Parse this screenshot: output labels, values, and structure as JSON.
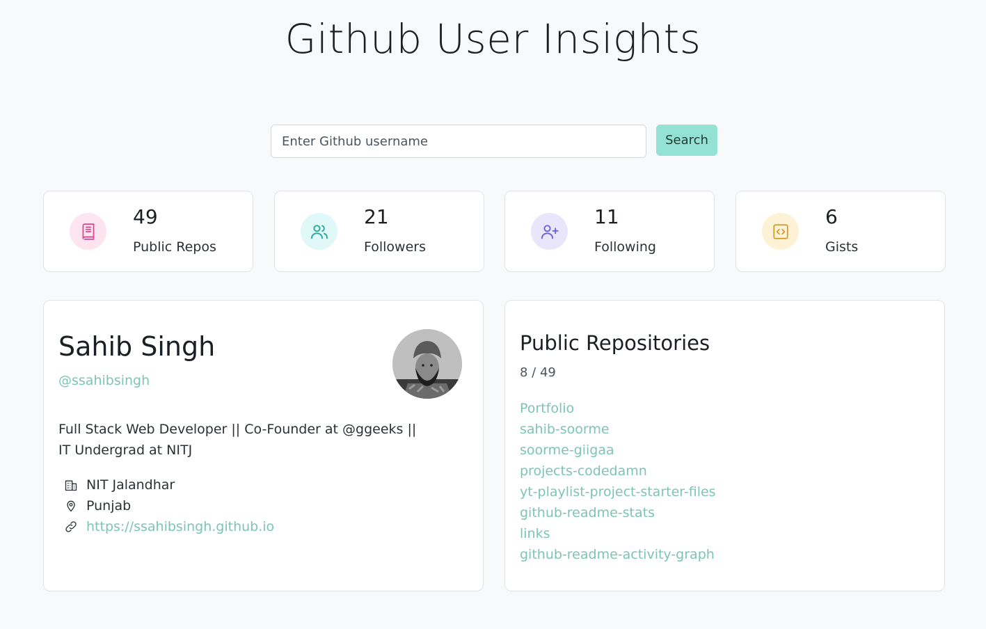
{
  "header": {
    "title": "Github User Insights"
  },
  "search": {
    "placeholder": "Enter Github username",
    "button_label": "Search"
  },
  "stats": [
    {
      "value": "49",
      "label": "Public Repos",
      "icon": "book-icon",
      "color": "#d6478f",
      "bg": "#fde4ef"
    },
    {
      "value": "21",
      "label": "Followers",
      "icon": "users-icon",
      "color": "#2aa59a",
      "bg": "#e0f8f7"
    },
    {
      "value": "11",
      "label": "Following",
      "icon": "user-plus-icon",
      "color": "#6c5ed6",
      "bg": "#e9e6fb"
    },
    {
      "value": "6",
      "label": "Gists",
      "icon": "code-icon",
      "color": "#d19a2a",
      "bg": "#fdf1d6"
    }
  ],
  "profile": {
    "name": "Sahib Singh",
    "handle": "@ssahibsingh",
    "bio": "Full Stack Web Developer || Co-Founder at @ggeeks || IT Undergrad at NITJ",
    "company": "NIT Jalandhar",
    "location": "Punjab",
    "website": "https://ssahibsingh.github.io"
  },
  "repos": {
    "title": "Public Repositories",
    "count": "8 / 49",
    "items": [
      "Portfolio",
      "sahib-soorme",
      "soorme-giigaa",
      "projects-codedamn",
      "yt-playlist-project-starter-files",
      "github-readme-stats",
      "links",
      "github-readme-activity-graph"
    ]
  },
  "colors": {
    "accent": "#94e2d3",
    "link": "#7cc4b3"
  }
}
